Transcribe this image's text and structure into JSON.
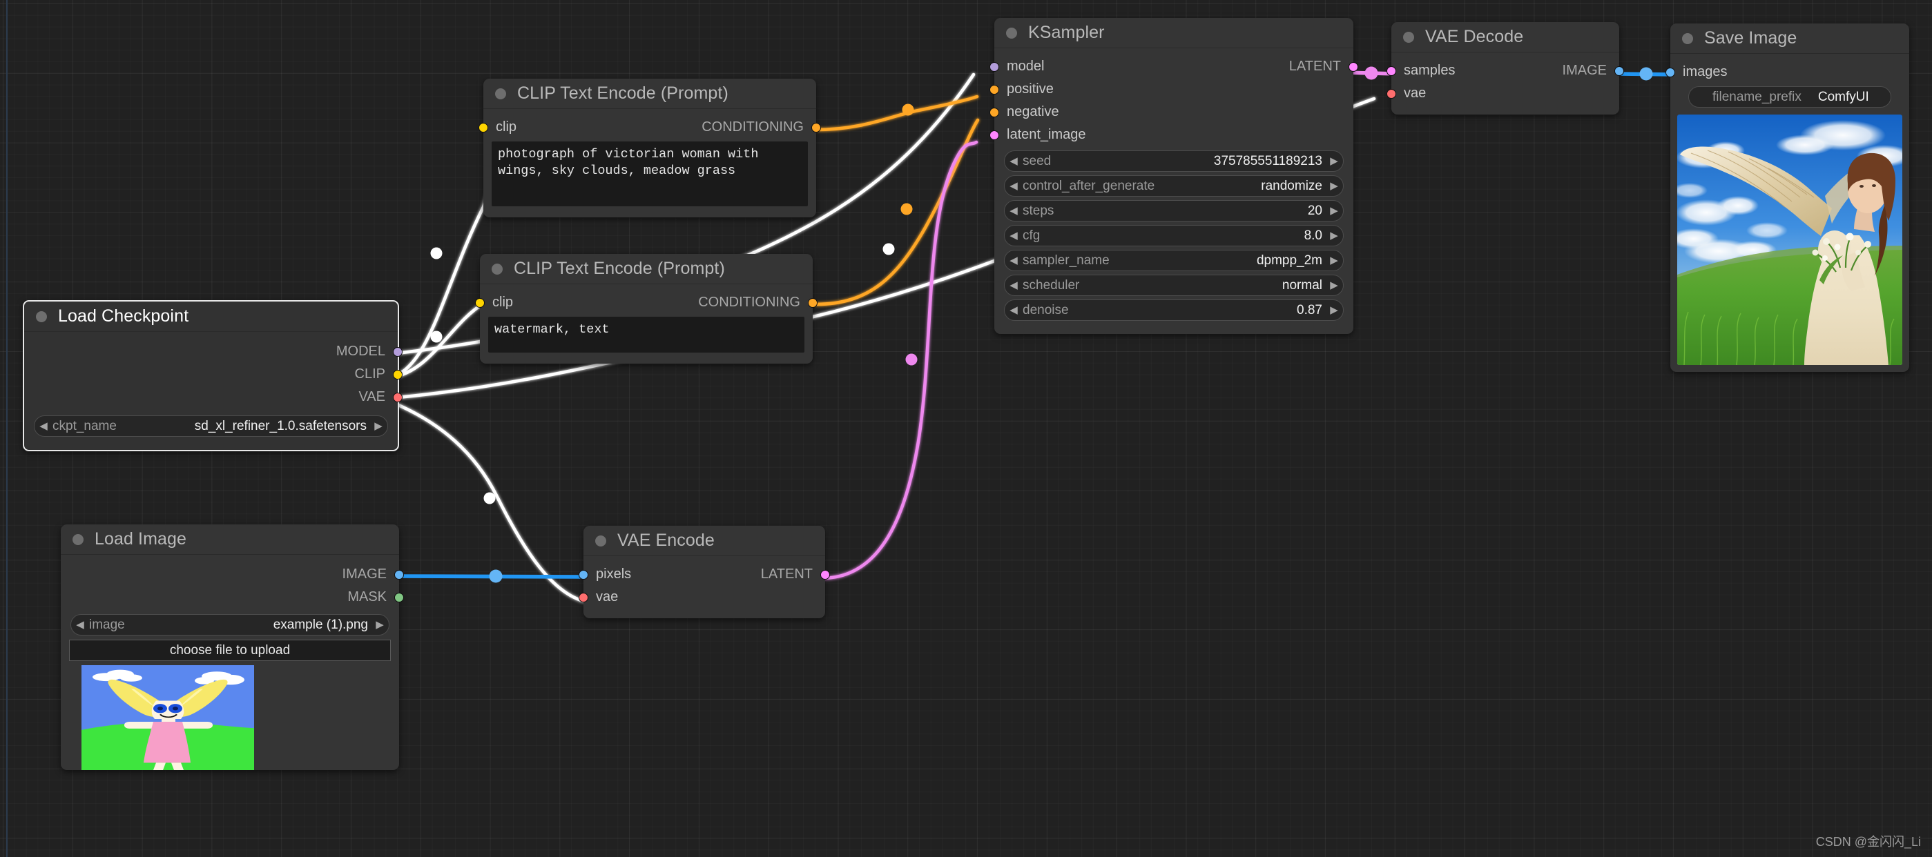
{
  "app": {
    "watermark": "CSDN @金闪闪_Li"
  },
  "colors": {
    "model": "#b39ddb",
    "clip": "#ffd500",
    "vae": "#ff6e6e",
    "conditioning": "#ffa726",
    "latent": "#ff86ff",
    "image": "#64b5f6",
    "mask": "#81c784",
    "wire_default": "#ffffff"
  },
  "nodes": {
    "load_checkpoint": {
      "title": "Load Checkpoint",
      "outputs": [
        {
          "label": "MODEL",
          "type": "model"
        },
        {
          "label": "CLIP",
          "type": "clip"
        },
        {
          "label": "VAE",
          "type": "vae"
        }
      ],
      "widgets": [
        {
          "name": "ckpt_name",
          "value": "sd_xl_refiner_1.0.safetensors",
          "left_arrow": "◀",
          "right_arrow": "▶"
        }
      ]
    },
    "clip_positive": {
      "title": "CLIP Text Encode (Prompt)",
      "inputs": [
        {
          "label": "clip",
          "type": "clip"
        }
      ],
      "outputs": [
        {
          "label": "CONDITIONING",
          "type": "conditioning"
        }
      ],
      "text": "photograph of victorian woman with wings, sky clouds, meadow grass"
    },
    "clip_negative": {
      "title": "CLIP Text Encode (Prompt)",
      "inputs": [
        {
          "label": "clip",
          "type": "clip"
        }
      ],
      "outputs": [
        {
          "label": "CONDITIONING",
          "type": "conditioning"
        }
      ],
      "text": "watermark, text"
    },
    "ksampler": {
      "title": "KSampler",
      "inputs": [
        {
          "label": "model",
          "type": "model"
        },
        {
          "label": "positive",
          "type": "conditioning"
        },
        {
          "label": "negative",
          "type": "conditioning"
        },
        {
          "label": "latent_image",
          "type": "latent"
        }
      ],
      "outputs": [
        {
          "label": "LATENT",
          "type": "latent"
        }
      ],
      "widgets": [
        {
          "name": "seed",
          "value": "375785551189213",
          "left_arrow": "◀",
          "right_arrow": "▶"
        },
        {
          "name": "control_after_generate",
          "value": "randomize",
          "left_arrow": "◀",
          "right_arrow": "▶"
        },
        {
          "name": "steps",
          "value": "20",
          "left_arrow": "◀",
          "right_arrow": "▶"
        },
        {
          "name": "cfg",
          "value": "8.0",
          "left_arrow": "◀",
          "right_arrow": "▶"
        },
        {
          "name": "sampler_name",
          "value": "dpmpp_2m",
          "left_arrow": "◀",
          "right_arrow": "▶"
        },
        {
          "name": "scheduler",
          "value": "normal",
          "left_arrow": "◀",
          "right_arrow": "▶"
        },
        {
          "name": "denoise",
          "value": "0.87",
          "left_arrow": "◀",
          "right_arrow": "▶"
        }
      ]
    },
    "vae_decode": {
      "title": "VAE Decode",
      "inputs": [
        {
          "label": "samples",
          "type": "latent"
        },
        {
          "label": "vae",
          "type": "vae"
        }
      ],
      "outputs": [
        {
          "label": "IMAGE",
          "type": "image"
        }
      ]
    },
    "save_image": {
      "title": "Save Image",
      "inputs": [
        {
          "label": "images",
          "type": "image"
        }
      ],
      "widgets": [
        {
          "name": "filename_prefix",
          "value": "ComfyUI"
        }
      ],
      "preview_alt": "victorian woman with wings in meadow under blue sky"
    },
    "load_image": {
      "title": "Load Image",
      "outputs": [
        {
          "label": "IMAGE",
          "type": "image"
        },
        {
          "label": "MASK",
          "type": "mask"
        }
      ],
      "widgets": [
        {
          "name": "image",
          "value": "example (1).png",
          "left_arrow": "◀",
          "right_arrow": "▶"
        }
      ],
      "upload_label": "choose file to upload",
      "preview_alt": "child drawing of girl with yellow wings on green grass"
    },
    "vae_encode": {
      "title": "VAE Encode",
      "inputs": [
        {
          "label": "pixels",
          "type": "image"
        },
        {
          "label": "vae",
          "type": "vae"
        }
      ],
      "outputs": [
        {
          "label": "LATENT",
          "type": "latent"
        }
      ]
    }
  }
}
